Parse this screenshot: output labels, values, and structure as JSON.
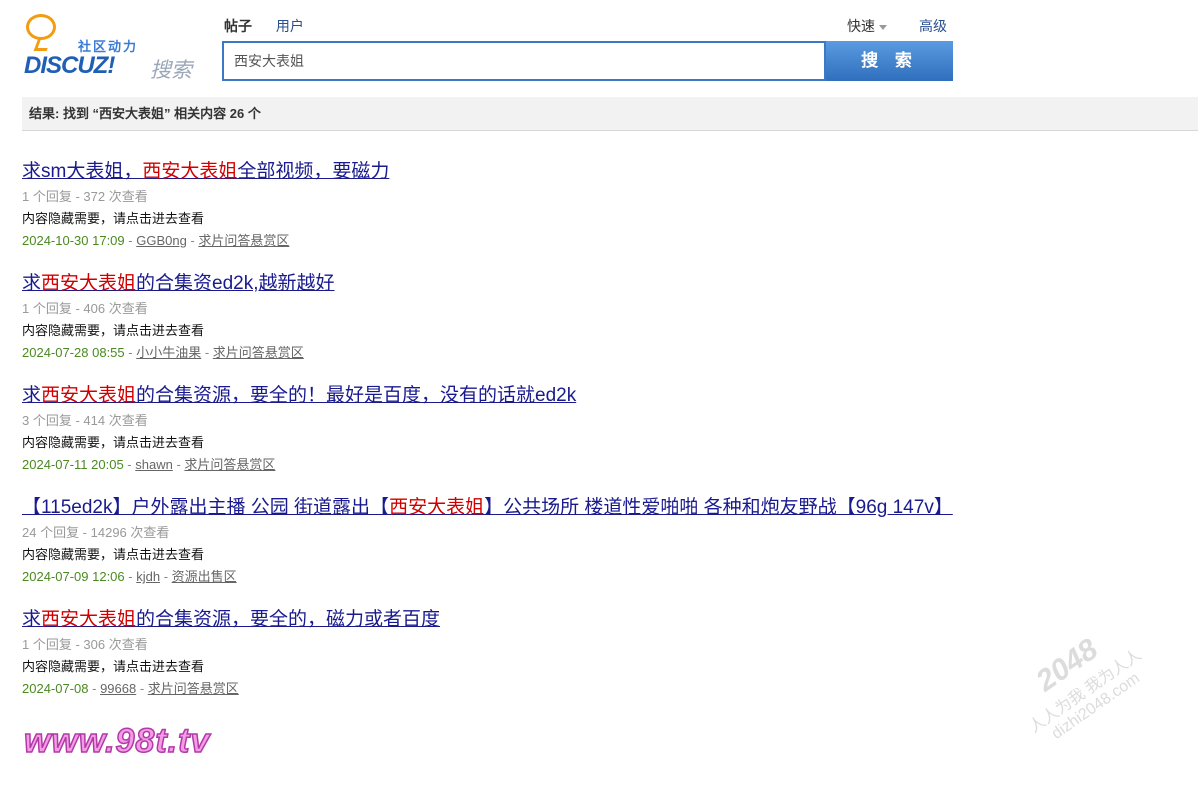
{
  "logo": {
    "cn": "社区动力",
    "brand": "DISCUZ!",
    "search_word": "搜索"
  },
  "tabs": {
    "posts": "帖子",
    "users": "用户"
  },
  "quick": "快速",
  "advanced": "高级",
  "search": {
    "value": "西安大表姐",
    "button": "搜 索"
  },
  "summary": "结果: 找到 “西安大表姐” 相关内容 26 个",
  "results": [
    {
      "pre": "求sm大表姐，",
      "hl": "西安大表姐",
      "post": "全部视频，要磁力",
      "stats": "1 个回复 - 372 次查看",
      "desc": "内容隐藏需要，请点击进去查看",
      "date": "2024-10-30 17:09",
      "author": "GGB0ng",
      "forum": "求片问答悬赏区"
    },
    {
      "pre": "求",
      "hl": "西安大表姐",
      "post": "的合集资ed2k,越新越好",
      "stats": "1 个回复 - 406 次查看",
      "desc": "内容隐藏需要，请点击进去查看",
      "date": "2024-07-28 08:55",
      "author": "小小牛油果",
      "forum": "求片问答悬赏区"
    },
    {
      "pre": "求",
      "hl": "西安大表姐",
      "post": "的合集资源，要全的！最好是百度，没有的话就ed2k",
      "stats": "3 个回复 - 414 次查看",
      "desc": "内容隐藏需要，请点击进去查看",
      "date": "2024-07-11 20:05",
      "author": "shawn",
      "forum": "求片问答悬赏区"
    },
    {
      "pre": "【115ed2k】户外露出主播 公园 街道露出【",
      "hl": "西安大表姐",
      "post": "】公共场所 楼道性爱啪啪 各种和炮友野战【96g 147v】",
      "stats": "24 个回复 - 14296 次查看",
      "desc": "内容隐藏需要，请点击进去查看",
      "date": "2024-07-09 12:06",
      "author": "kjdh",
      "forum": "资源出售区"
    },
    {
      "pre": "求",
      "hl": "西安大表姐",
      "post": "的合集资源，要全的，磁力或者百度",
      "stats": "1 个回复 - 306 次查看",
      "desc": "内容隐藏需要，请点击进去查看",
      "date": "2024-07-08",
      "author": "99668",
      "forum": "求片问答悬赏区"
    }
  ],
  "watermark_98": "www.98t.tv",
  "watermark_2048": {
    "big": "2048",
    "line1": "人人为我 我为人人",
    "line2": "dizhi2048.com"
  }
}
